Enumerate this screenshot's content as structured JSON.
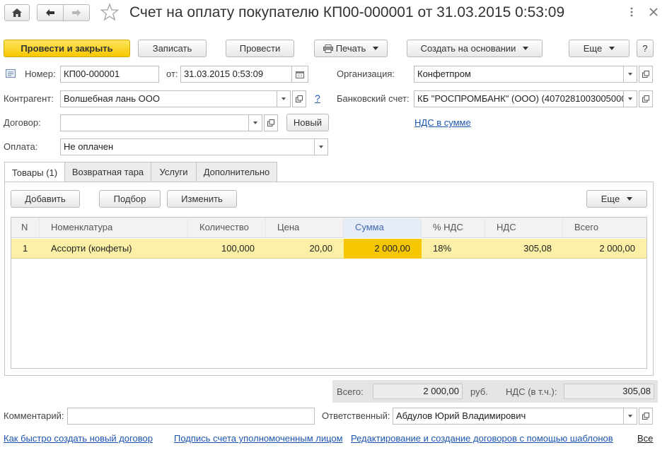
{
  "window": {
    "title": "Счет на оплату покупателю КП00-000001 от 31.03.2015 0:53:09"
  },
  "toolbar": {
    "post_close": "Провести и закрыть",
    "write": "Записать",
    "post": "Провести",
    "print": "Печать",
    "create_based": "Создать на основании",
    "more": "Еще",
    "help": "?"
  },
  "form": {
    "number_label": "Номер:",
    "number_value": "КП00-000001",
    "date_label": "от:",
    "date_value": "31.03.2015  0:53:09",
    "org_label": "Организация:",
    "org_value": "Конфетпром",
    "counterparty_label": "Контрагент:",
    "counterparty_value": "Волшебная лань ООО",
    "counterparty_help": "?",
    "bank_label": "Банковский счет:",
    "bank_value": "КБ \"РОСПРОМБАНК\" (ООО) (40702810030050000",
    "contract_label": "Договор:",
    "contract_value": "",
    "new_button": "Новый",
    "vat_link": "НДС в сумме",
    "payment_label": "Оплата:",
    "payment_value": "Не оплачен"
  },
  "tabs": [
    {
      "label": "Товары (1)"
    },
    {
      "label": "Возвратная тара"
    },
    {
      "label": "Услуги"
    },
    {
      "label": "Дополнительно"
    }
  ],
  "table_toolbar": {
    "add": "Добавить",
    "select": "Подбор",
    "change": "Изменить",
    "more": "Еще"
  },
  "table": {
    "columns": [
      "N",
      "Номенклатура",
      "Количество",
      "Цена",
      "Сумма",
      "% НДС",
      "НДС",
      "Всего"
    ],
    "rows": [
      {
        "n": "1",
        "item": "Ассорти (конфеты)",
        "qty": "100,000",
        "price": "20,00",
        "sum": "2 000,00",
        "vat_rate": "18%",
        "vat": "305,08",
        "total": "2 000,00"
      }
    ]
  },
  "totals": {
    "total_label": "Всего:",
    "total_value": "2 000,00",
    "currency": "руб.",
    "vat_label": "НДС (в т.ч.):",
    "vat_value": "305,08"
  },
  "footer": {
    "comment_label": "Комментарий:",
    "comment_value": "",
    "responsible_label": "Ответственный:",
    "responsible_value": "Абдулов Юрий Владимирович",
    "links": [
      "Как быстро создать новый договор",
      "Подпись счета уполномоченным лицом",
      "Редактирование и создание договоров с помощью шаблонов"
    ],
    "all_link": "Все"
  },
  "colors": {
    "accent_yellow": "#f6c700",
    "row_highlight": "#fbf0a6",
    "active_cell": "#f6c700",
    "link": "#1c55b0"
  }
}
